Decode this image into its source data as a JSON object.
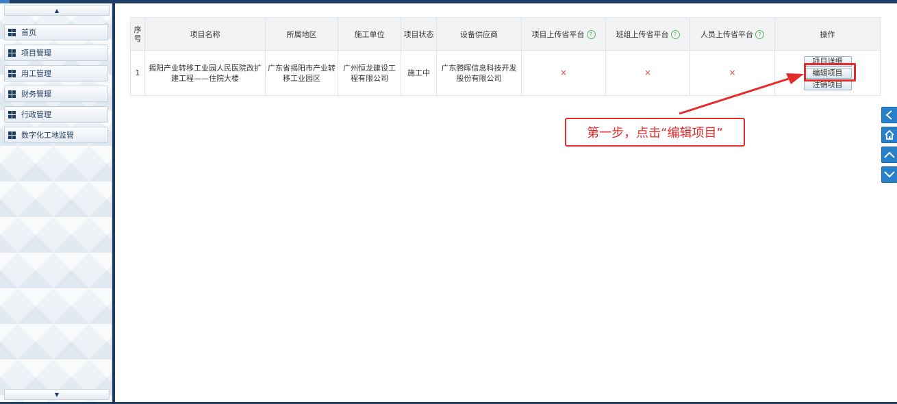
{
  "sidebar": {
    "items": [
      {
        "label": "首页"
      },
      {
        "label": "项目管理"
      },
      {
        "label": "用工管理"
      },
      {
        "label": "财务管理"
      },
      {
        "label": "行政管理"
      },
      {
        "label": "数字化工地监管"
      }
    ]
  },
  "table": {
    "headers": {
      "index": "序号",
      "name": "项目名称",
      "region": "所属地区",
      "builder": "施工单位",
      "status": "项目状态",
      "supplier": "设备供应商",
      "proj_upload": "项目上传省平台",
      "team_upload": "班组上传省平台",
      "staff_upload": "人员上传省平台",
      "actions": "操作"
    },
    "rows": [
      {
        "index": "1",
        "name": "揭阳产业转移工业园人民医院改扩建工程——住院大楼",
        "region": "广东省揭阳市产业转移工业园区",
        "builder": "广州恒龙建设工程有限公司",
        "status": "施工中",
        "supplier": "广东腾晖信息科技开发股份有限公司",
        "proj_upload": "×",
        "team_upload": "×",
        "staff_upload": "×",
        "actions": {
          "detail": "项目详细",
          "edit": "编辑项目",
          "cancel": "注销项目"
        }
      }
    ]
  },
  "help_icon_glyph": "?",
  "annotation": {
    "callout_text": "第一步，点击“编辑项目”",
    "color": "#e52b2b"
  },
  "side_nav": [
    "chevron-left-icon",
    "home-icon",
    "chevron-up-icon",
    "chevron-down-icon"
  ],
  "colors": {
    "frame": "#1d3f66",
    "accent": "#2780c9",
    "error": "#e04646",
    "help": "#57b45d"
  }
}
